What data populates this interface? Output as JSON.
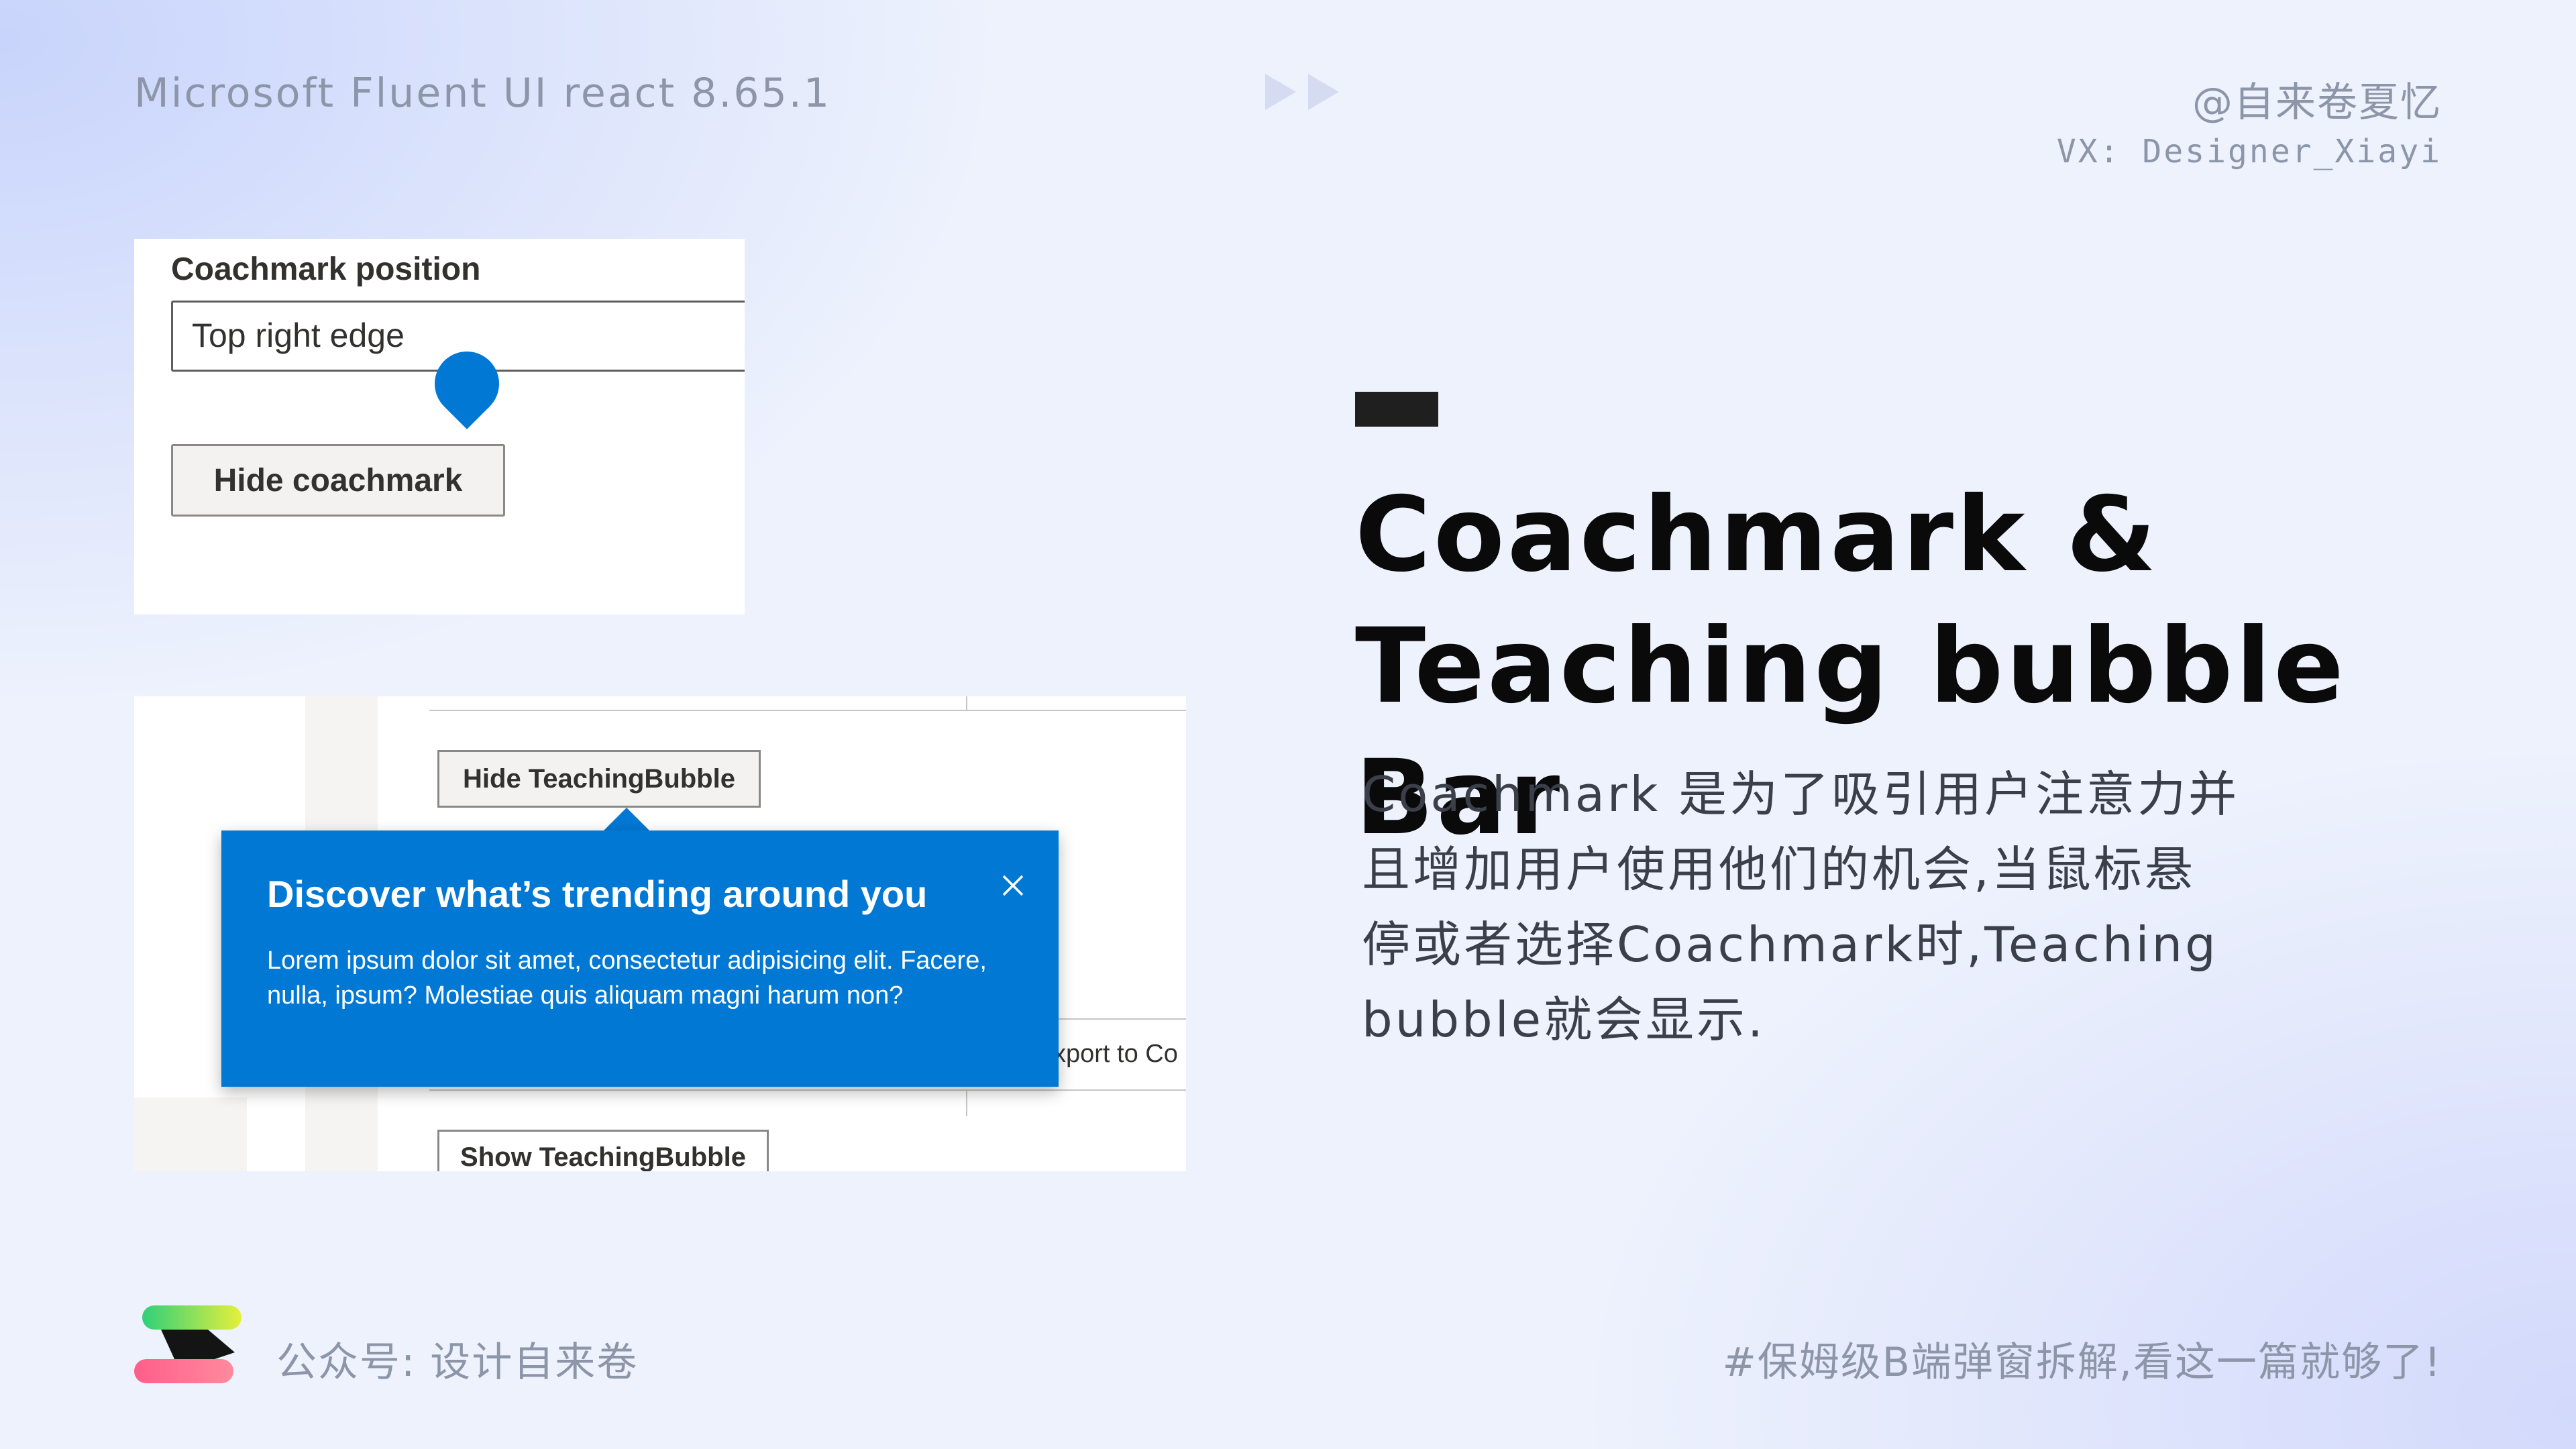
{
  "header": {
    "left": "Microsoft Fluent UI react 8.65.1",
    "author": "@自来卷夏忆",
    "contact": "VX: Designer_Xiayi"
  },
  "coachmark_demo": {
    "label": "Coachmark position",
    "input_value": "Top right edge",
    "hide_button": "Hide coachmark"
  },
  "teaching_bubble_demo": {
    "hide_button": "Hide TeachingBubble",
    "show_button": "Show TeachingBubble",
    "export_label": "xport to Co",
    "bubble_title": "Discover what’s trending around you",
    "bubble_body": "Lorem ipsum dolor sit amet, consectetur adipisicing elit. Facere, nulla, ipsum? Molestiae quis aliquam magni harum non?"
  },
  "main": {
    "title_line1": "Coachmark &",
    "title_line2": "Teaching bubble Bar",
    "desc_line1": "Coachmark 是为了吸引用户注意力并",
    "desc_line2": "且增加用户使用他们的机会,当鼠标悬",
    "desc_line3": "停或者选择Coachmark时,Teaching",
    "desc_line4": "bubble就会显示."
  },
  "footer": {
    "left": "公众号: 设计自来卷",
    "right": "#保姆级B端弹窗拆解,看这一篇就够了!"
  },
  "colors": {
    "accent": "#0078d4",
    "title": "#0a0a0a",
    "muted": "#8c96a8"
  }
}
